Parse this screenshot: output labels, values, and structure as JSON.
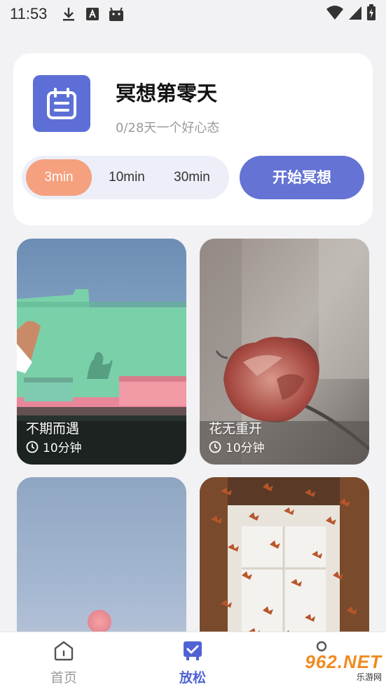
{
  "status_bar": {
    "time": "11:53",
    "icons": [
      "download-icon",
      "a-notification-icon",
      "android-icon"
    ],
    "right_icons": [
      "wifi-icon",
      "signal-icon",
      "battery-charging-icon"
    ]
  },
  "meditation": {
    "title": "冥想第零天",
    "subtitle": "0/28天一个好心态",
    "durations": [
      "3min",
      "10min",
      "30min"
    ],
    "selected_duration": "3min",
    "start_label": "开始冥想"
  },
  "cards": [
    {
      "title": "不期而遇",
      "duration": "10分钟"
    },
    {
      "title": "花无重开",
      "duration": "10分钟"
    },
    {
      "title": "",
      "duration": ""
    },
    {
      "title": "",
      "duration": ""
    }
  ],
  "nav": {
    "items": [
      {
        "label": "首页",
        "icon": "home-icon"
      },
      {
        "label": "放松",
        "icon": "relax-icon"
      },
      {
        "label": "",
        "icon": "profile-icon"
      }
    ],
    "active": "放松"
  },
  "watermark": {
    "main": "962.NET",
    "sub": "乐游网"
  },
  "colors": {
    "accent": "#6473d4",
    "selected_duration": "#f5a07e",
    "nav_active": "#4f63d6",
    "background": "#f2f2f4"
  }
}
